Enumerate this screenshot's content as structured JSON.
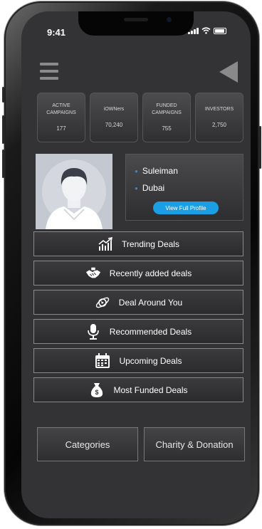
{
  "status_bar": {
    "time": "9:41"
  },
  "stats": [
    {
      "label": "ACTIVE CAMPAIGNS",
      "value": "177"
    },
    {
      "label": "iOWNers",
      "value": "70,240"
    },
    {
      "label": "FUNDED CAMPAIGNS",
      "value": "755"
    },
    {
      "label": "INVESTORS",
      "value": "2,750"
    }
  ],
  "profile": {
    "name": "Suleiman",
    "location": "Dubai",
    "button": "View Full Profile"
  },
  "deals": [
    {
      "label": "Trending Deals",
      "icon": "trending-chart-icon"
    },
    {
      "label": "Recently added deals",
      "icon": "handshake-icon"
    },
    {
      "label": "Deal Around You",
      "icon": "globe-orbit-icon"
    },
    {
      "label": "Recommended Deals",
      "icon": "microphone-icon"
    },
    {
      "label": "Upcoming Deals",
      "icon": "calendar-icon"
    },
    {
      "label": "Most Funded Deals",
      "icon": "money-bag-icon"
    }
  ],
  "bottom": {
    "categories": "Categories",
    "charity": "Charity & Donation"
  },
  "colors": {
    "screen_bg": "#333335",
    "accent": "#1b9ee3",
    "text": "#ffffff"
  }
}
